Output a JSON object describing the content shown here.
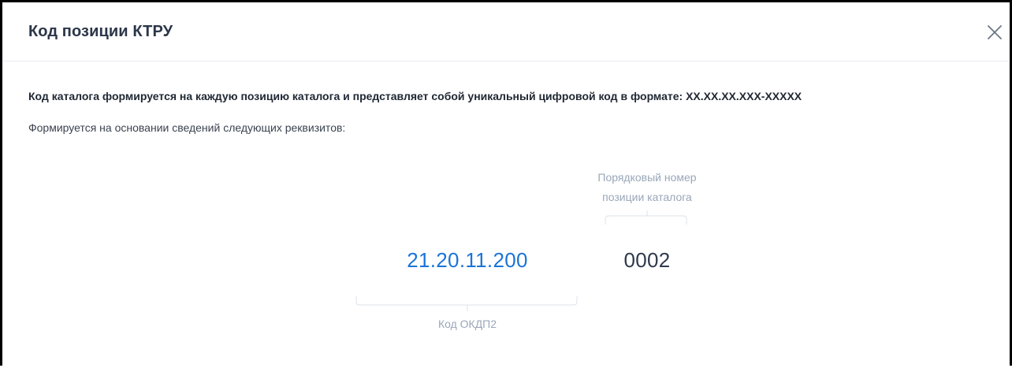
{
  "dialog": {
    "title": "Код позиции КТРУ",
    "close_icon": "close-icon"
  },
  "description": {
    "bold_text": "Код каталога формируется на каждую позицию каталога и представляет собой уникальный цифровой код в формате: XX.XX.XX.XXX-XXXXX",
    "normal_text": "Формируется на основании сведений следующих реквизитов:"
  },
  "diagram": {
    "okpd_code": "21.20.11.200",
    "okpd_label": "Код ОКДП2",
    "position_code": "0002",
    "position_label_line1": "Порядковый номер",
    "position_label_line2": "позиции каталога"
  },
  "colors": {
    "accent_blue": "#1a74d8",
    "muted_label": "#9aa6b8",
    "title_text": "#2b3648"
  }
}
